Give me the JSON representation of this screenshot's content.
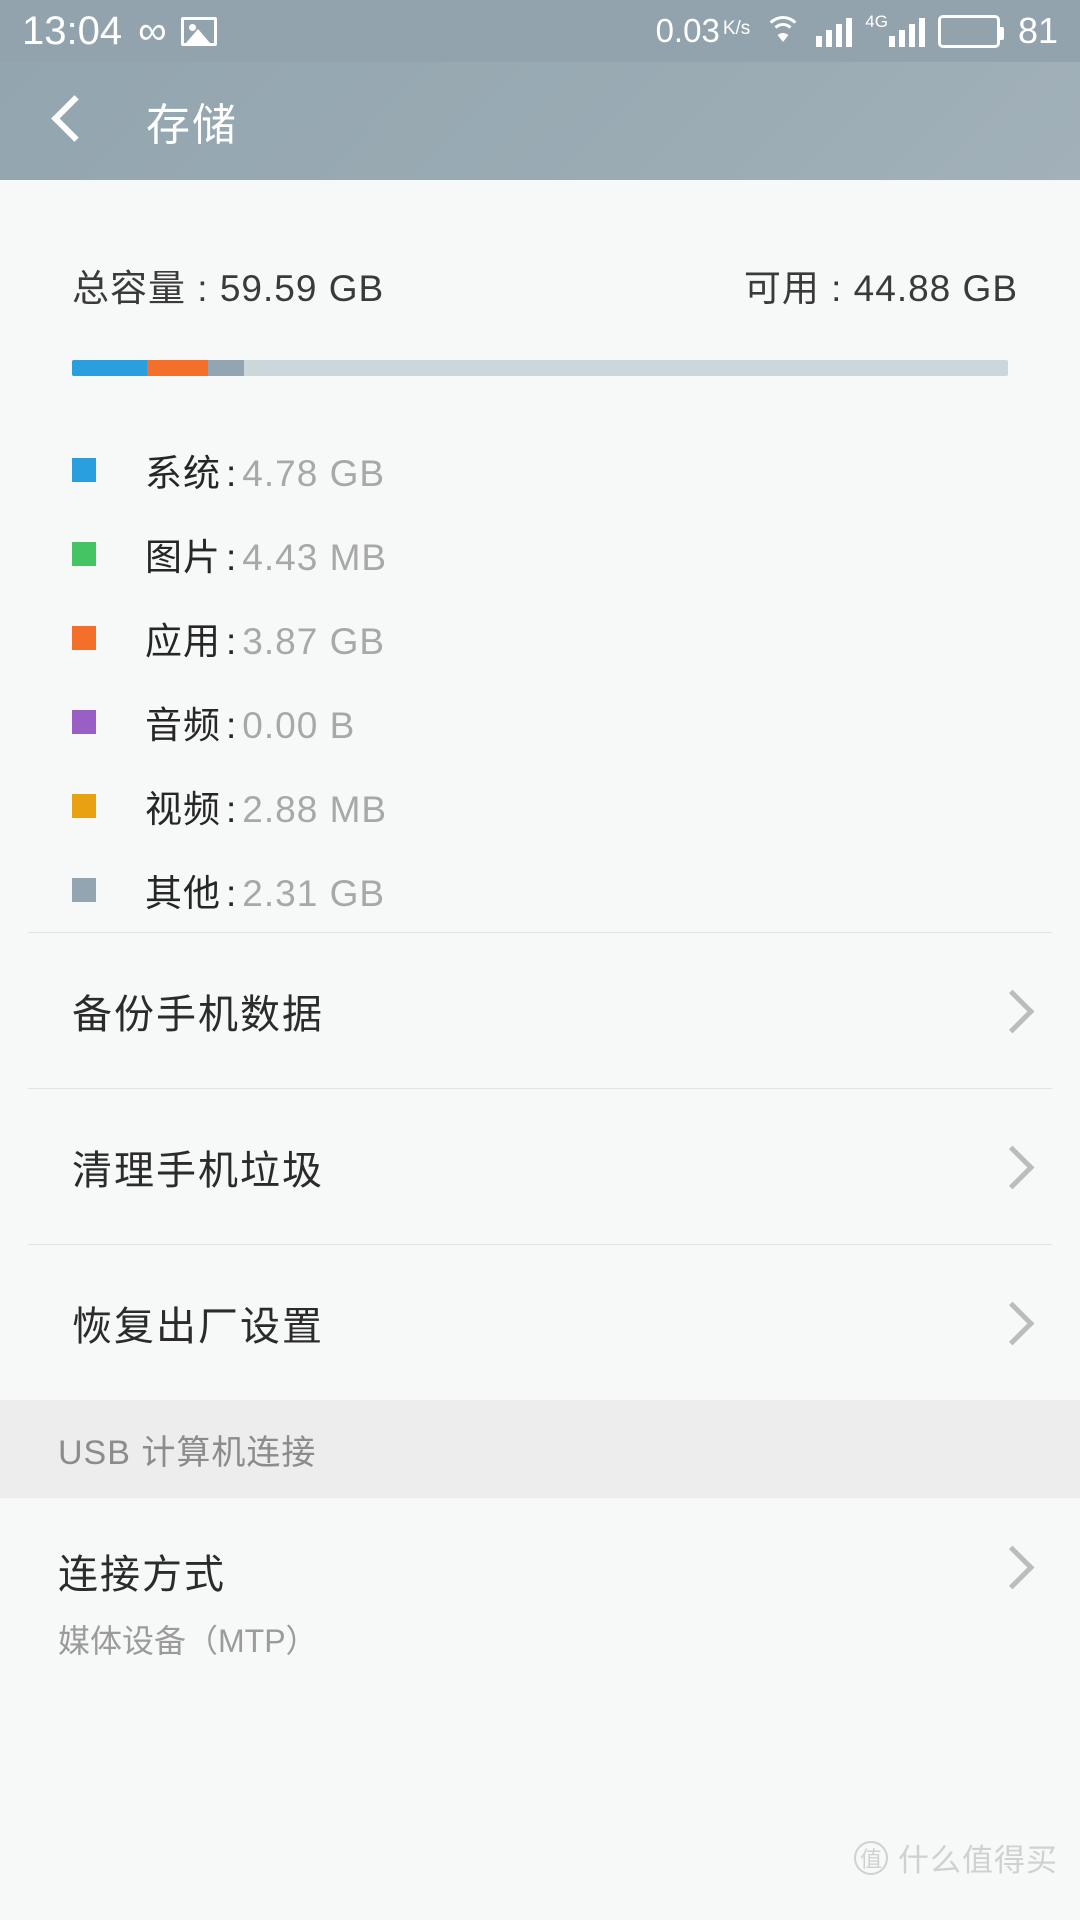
{
  "statusbar": {
    "time": "13:04",
    "infinity_icon": "infinity-icon",
    "photo_icon": "gallery-icon",
    "network_speed": "0.03",
    "network_speed_unit": "K/s",
    "wifi_icon": "wifi-icon",
    "signal_icon": "signal-bars-icon",
    "mobile_network_label": "4G",
    "battery_icon": "battery-icon",
    "battery_level": "81"
  },
  "appbar": {
    "back_icon": "back-chevron-icon",
    "title": "存储"
  },
  "summary": {
    "total_label": "总容量 : 59.59 GB",
    "free_label": "可用 : 44.88 GB",
    "total_value": "59.59 GB",
    "free_value": "44.88 GB"
  },
  "chart_data": {
    "type": "bar",
    "title": "存储使用情况",
    "total_gb": 59.59,
    "free_gb": 44.88,
    "categories": [
      "系统",
      "图片",
      "应用",
      "音频",
      "视频",
      "其他"
    ],
    "values_gb": [
      4.78,
      0.00443,
      3.87,
      0.0,
      0.00288,
      2.31
    ],
    "display_values": [
      "4.78 GB",
      "4.43 MB",
      "3.87 GB",
      "0.00 B",
      "2.88 MB",
      "2.31 GB"
    ],
    "colors": [
      "#2a9fe0",
      "#44c462",
      "#f4702a",
      "#9a5fc4",
      "#e9a112",
      "#93a5b0"
    ],
    "track_color": "#ccd7dc",
    "legend_position": "below"
  },
  "legend": [
    {
      "name": "系统",
      "value": "4.78 GB",
      "color": "#2a9fe0"
    },
    {
      "name": "图片",
      "value": "4.43 MB",
      "color": "#44c462"
    },
    {
      "name": "应用",
      "value": "3.87 GB",
      "color": "#f4702a"
    },
    {
      "name": "音频",
      "value": "0.00 B",
      "color": "#9a5fc4"
    },
    {
      "name": "视频",
      "value": "2.88 MB",
      "color": "#e9a112"
    },
    {
      "name": "其他",
      "value": "2.31 GB",
      "color": "#93a5b0"
    }
  ],
  "separator": ":",
  "nav_rows": [
    {
      "label": "备份手机数据",
      "chevron": "chevron-right-icon"
    },
    {
      "label": "清理手机垃圾",
      "chevron": "chevron-right-icon"
    },
    {
      "label": "恢复出厂设置",
      "chevron": "chevron-right-icon"
    }
  ],
  "usb_section": {
    "header": "USB 计算机连接",
    "item_title": "连接方式",
    "item_subtitle": "媒体设备（MTP）"
  },
  "watermark": {
    "logo": "值",
    "text": "什么值得买"
  }
}
